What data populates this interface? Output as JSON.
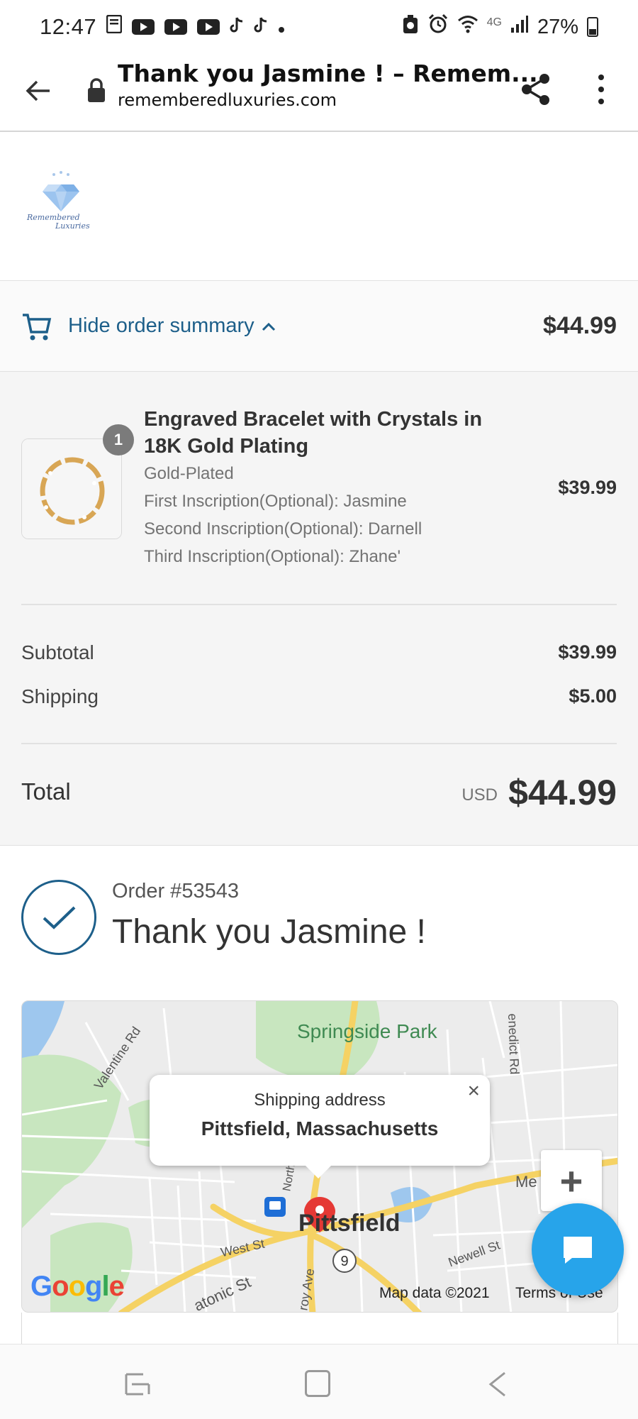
{
  "status_bar": {
    "time": "12:47",
    "network": "4G",
    "battery": "27%"
  },
  "browser": {
    "page_title": "Thank you Jasmine ! – Remem...",
    "domain": "rememberedluxuries.com",
    "icons": [
      "back-arrow-icon",
      "lock-icon",
      "share-icon",
      "more-vert-icon"
    ]
  },
  "logo": {
    "text_line1": "Remembered",
    "text_line2": "Luxuries"
  },
  "summary_toggle": {
    "label": "Hide order summary",
    "total": "$44.99"
  },
  "product": {
    "quantity": "1",
    "name": "Engraved Bracelet with Crystals in 18K Gold Plating",
    "variant": "Gold-Plated",
    "inscriptions": [
      "First Inscription(Optional): Jasmine",
      "Second Inscription(Optional): Darnell",
      "Third Inscription(Optional): Zhane'"
    ],
    "price": "$39.99"
  },
  "totals": {
    "subtotal_label": "Subtotal",
    "subtotal_value": "$39.99",
    "shipping_label": "Shipping",
    "shipping_value": "$5.00",
    "total_label": "Total",
    "currency": "USD",
    "total_value": "$44.99"
  },
  "confirmation": {
    "order_number": "Order #53543",
    "thank_you": "Thank you Jasmine !"
  },
  "map": {
    "park": "Springside Park",
    "city": "Pittsfield",
    "popup_title": "Shipping address",
    "popup_address": "Pittsfield, Massachusetts",
    "close_glyph": "×",
    "zoom_in": "+",
    "street_labels": {
      "valentine": "Valentine Rd",
      "benedict": "enedict Rd",
      "west": "West St",
      "newell": "Newell St",
      "tonic": "atonic St",
      "roy": "roy Ave",
      "north": "North St",
      "me": "Me",
      "route": "9"
    },
    "google": "Google",
    "attribution": "Map data ©2021",
    "terms": "Terms of Use",
    "colors": {
      "road_major": "#f5d264",
      "park": "#c8e6bf",
      "water": "#9ec7ee",
      "pin": "#e53935"
    }
  }
}
